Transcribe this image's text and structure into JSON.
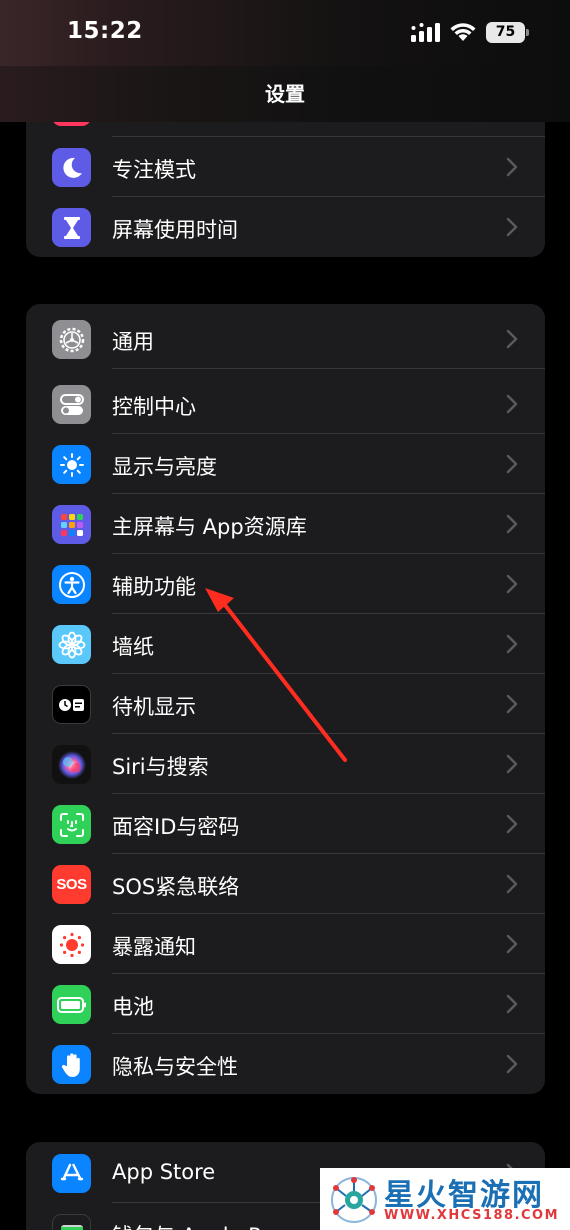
{
  "status_bar": {
    "time": "15:22",
    "battery_level": "75"
  },
  "header": {
    "title": "设置"
  },
  "group1": {
    "items": [
      {
        "label": "专注模式",
        "icon": "moon-icon",
        "color": "#5e5ce6"
      },
      {
        "label": "屏幕使用时间",
        "icon": "hourglass-icon",
        "color": "#5e5ce6"
      }
    ]
  },
  "group2": {
    "items": [
      {
        "label": "通用",
        "icon": "gear-icon",
        "color": "#8e8e93"
      },
      {
        "label": "控制中心",
        "icon": "toggles-icon",
        "color": "#8e8e93"
      },
      {
        "label": "显示与亮度",
        "icon": "sun-icon",
        "color": "#0a84ff"
      },
      {
        "label": "主屏幕与 App资源库",
        "icon": "app-grid-icon",
        "color": "#5e5ce6"
      },
      {
        "label": "辅助功能",
        "icon": "accessibility-icon",
        "color": "#0a84ff"
      },
      {
        "label": "墙纸",
        "icon": "flower-icon",
        "color": "#5ac8fa"
      },
      {
        "label": "待机显示",
        "icon": "standby-icon",
        "color": "#000000"
      },
      {
        "label": "Siri与搜索",
        "icon": "siri-icon",
        "color": "#111111"
      },
      {
        "label": "面容ID与密码",
        "icon": "face-id-icon",
        "color": "#30d158"
      },
      {
        "label": "SOS紧急联络",
        "icon": "sos-icon",
        "color": "#ff3b30",
        "icon_text": "SOS"
      },
      {
        "label": "暴露通知",
        "icon": "exposure-icon",
        "color": "#ffffff"
      },
      {
        "label": "电池",
        "icon": "battery-icon",
        "color": "#30d158"
      },
      {
        "label": "隐私与安全性",
        "icon": "hand-icon",
        "color": "#0a84ff"
      }
    ]
  },
  "group3": {
    "items": [
      {
        "label": "App Store",
        "icon": "app-store-icon",
        "color": "#0a84ff"
      },
      {
        "label": "钱包与 Apple Pay",
        "icon": "wallet-icon",
        "color": "#1c1c1e"
      }
    ]
  },
  "watermark": {
    "title": "星火智游网",
    "url": "WWW.XHCS188.COM"
  }
}
